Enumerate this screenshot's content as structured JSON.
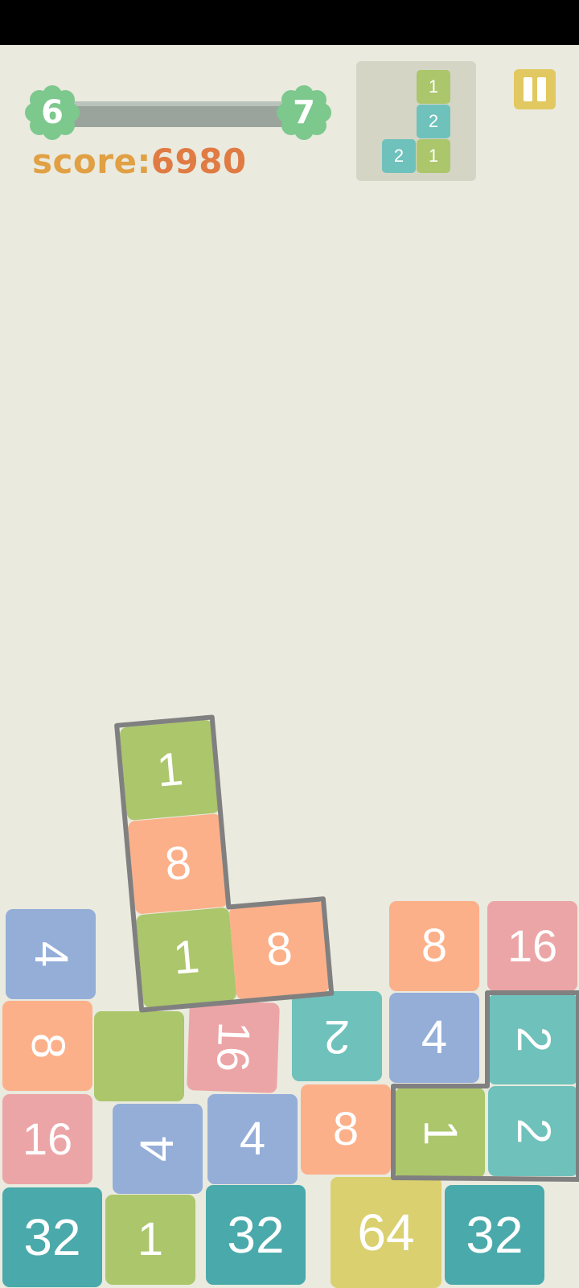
{
  "hud": {
    "current_level": "6",
    "next_level": "7",
    "level_progress": 1.0,
    "score_label": "score:",
    "score_value": "6980"
  },
  "next_piece": [
    {
      "value": "1",
      "color": "#abc66b"
    },
    {
      "value": "2",
      "color": "#6fc1bb"
    },
    {
      "value": "2",
      "color": "#6fc1bb"
    },
    {
      "value": "1",
      "color": "#abc66b"
    }
  ],
  "colors": {
    "v1": "#abc66b",
    "v2": "#6fc1bb",
    "v4": "#94aed8",
    "v8": "#fcb08a",
    "v16": "#eca5a6",
    "v32": "#4aa9aa",
    "v64": "#dad06f",
    "outline": "#808080",
    "background": "#eaeadf",
    "pause": "#e2c860",
    "level_badge": "#7dc88d",
    "score_label": "#e0a043",
    "score_value": "#e07b43"
  },
  "falling_piece": {
    "rotation_deg": -5,
    "tiles": [
      {
        "value": "1"
      },
      {
        "value": "8"
      },
      {
        "value": "1"
      },
      {
        "value": "8"
      }
    ]
  },
  "stack_tiles": [
    {
      "value": "4",
      "rotation": 90
    },
    {
      "value": "8",
      "rotation": 90
    },
    {
      "value": "",
      "rotation": 0
    },
    {
      "value": "16",
      "rotation": 90
    },
    {
      "value": "2",
      "rotation": 180
    },
    {
      "value": "4",
      "rotation": 0
    },
    {
      "value": "2",
      "rotation": 90
    },
    {
      "value": "8",
      "rotation": 0
    },
    {
      "value": "16",
      "rotation": 0
    },
    {
      "value": "16",
      "rotation": 0
    },
    {
      "value": "4",
      "rotation": 270
    },
    {
      "value": "4",
      "rotation": 0
    },
    {
      "value": "8",
      "rotation": 0
    },
    {
      "value": "1",
      "rotation": 90
    },
    {
      "value": "2",
      "rotation": 90
    },
    {
      "value": "32",
      "rotation": 0
    },
    {
      "value": "1",
      "rotation": 0
    },
    {
      "value": "32",
      "rotation": 0
    },
    {
      "value": "64",
      "rotation": 0
    },
    {
      "value": "32",
      "rotation": 0
    }
  ]
}
